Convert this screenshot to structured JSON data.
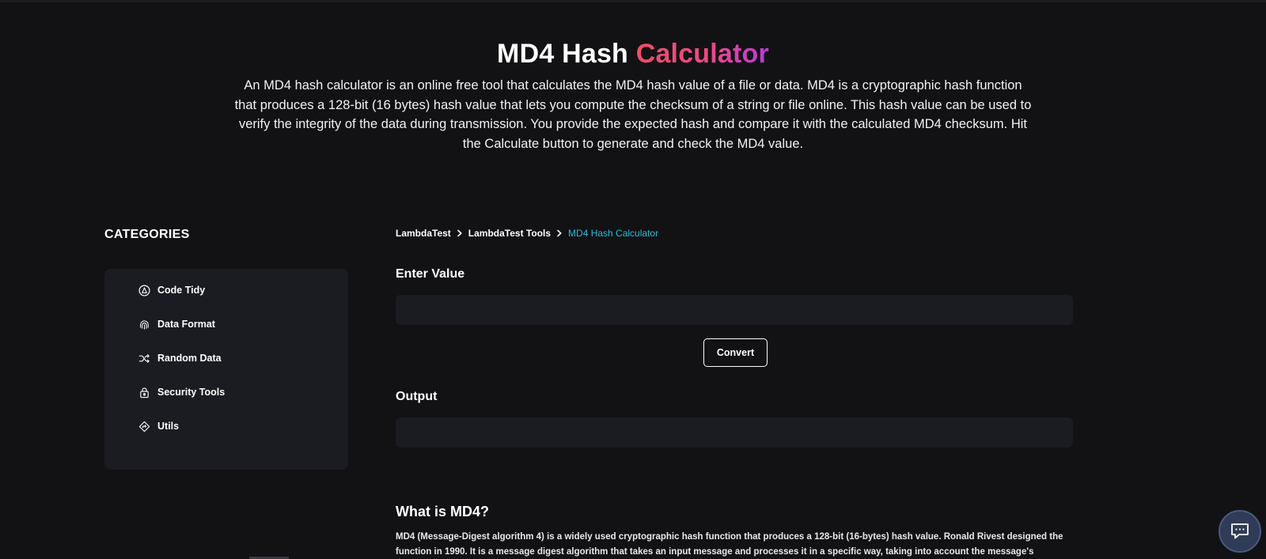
{
  "hero": {
    "title_main": "MD4 Hash",
    "title_accent": "Calculator",
    "description": "An MD4 hash calculator is an online free tool that calculates the MD4 hash value of a file or data. MD4 is a cryptographic hash function that produces a 128-bit (16 bytes) hash value that lets you compute the checksum of a string or file online. This hash value can be used to verify the integrity of the data during transmission. You provide the expected hash and compare it with the calculated MD4 checksum. Hit the Calculate button to generate and check the MD4 value."
  },
  "sidebar": {
    "title": "CATEGORIES",
    "items": [
      {
        "label": "Code Tidy",
        "icon": "code-tidy-icon"
      },
      {
        "label": "Data Format",
        "icon": "fingerprint-icon"
      },
      {
        "label": "Random Data",
        "icon": "shuffle-icon"
      },
      {
        "label": "Security Tools",
        "icon": "lock-icon"
      },
      {
        "label": "Utils",
        "icon": "utils-diamond-icon"
      }
    ]
  },
  "breadcrumb": {
    "items": [
      "LambdaTest",
      "LambdaTest Tools",
      "MD4 Hash Calculator"
    ]
  },
  "form": {
    "input_label": "Enter Value",
    "input_value": "",
    "convert_label": "Convert",
    "output_label": "Output",
    "output_value": ""
  },
  "article": {
    "title": "What is MD4?",
    "text": "MD4 (Message-Digest algorithm 4) is a widely used cryptographic hash function that produces a 128-bit (16-bytes) hash value. Ronald Rivest designed the function in 1990. It is a message digest algorithm that takes an input message and processes it in a specific way, taking into account the message's"
  },
  "colors": {
    "background": "#121214",
    "panel": "#1b1b22",
    "accent_gradient_start": "#ef4e6a",
    "accent_gradient_end": "#b73bd9",
    "breadcrumb_current": "#2ebbd1",
    "chat_button": "#2f3b57"
  },
  "chat": {
    "icon": "chat-bubble-icon"
  }
}
